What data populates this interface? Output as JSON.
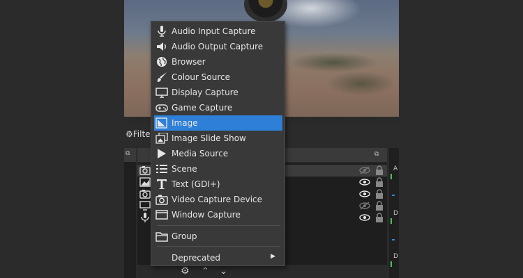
{
  "filters": {
    "label": "Filte"
  },
  "menu": {
    "items": [
      {
        "label": "Audio Input Capture",
        "icon": "microphone-icon"
      },
      {
        "label": "Audio Output Capture",
        "icon": "speaker-icon"
      },
      {
        "label": "Browser",
        "icon": "globe-icon"
      },
      {
        "label": "Colour Source",
        "icon": "paintbrush-icon"
      },
      {
        "label": "Display Capture",
        "icon": "monitor-icon"
      },
      {
        "label": "Game Capture",
        "icon": "gamepad-icon"
      },
      {
        "label": "Image",
        "icon": "image-icon",
        "active": true
      },
      {
        "label": "Image Slide Show",
        "icon": "slideshow-icon"
      },
      {
        "label": "Media Source",
        "icon": "play-icon"
      },
      {
        "label": "Scene",
        "icon": "list-icon"
      },
      {
        "label": "Text (GDI+)",
        "icon": "text-icon"
      },
      {
        "label": "Video Capture Device",
        "icon": "camera-icon"
      },
      {
        "label": "Window Capture",
        "icon": "window-icon"
      }
    ],
    "group": {
      "label": "Group",
      "icon": "folder-icon"
    },
    "deprecated": {
      "label": "Deprecated",
      "icon": "submenu-arrow-icon"
    }
  },
  "sources": {
    "rows": [
      {
        "icon": "camera-icon",
        "visible": false
      },
      {
        "icon": "image-icon",
        "visible": true
      },
      {
        "icon": "camera-icon",
        "visible": true
      },
      {
        "icon": "monitor-icon",
        "visible": false
      },
      {
        "icon": "microphone-icon",
        "visible": true
      }
    ]
  },
  "mixer": {
    "labels": [
      "A",
      "D",
      "D"
    ]
  },
  "colors": {
    "menu_bg": "#393939",
    "highlight": "#2d7fd8",
    "dock_bg": "#1e1e1e"
  }
}
